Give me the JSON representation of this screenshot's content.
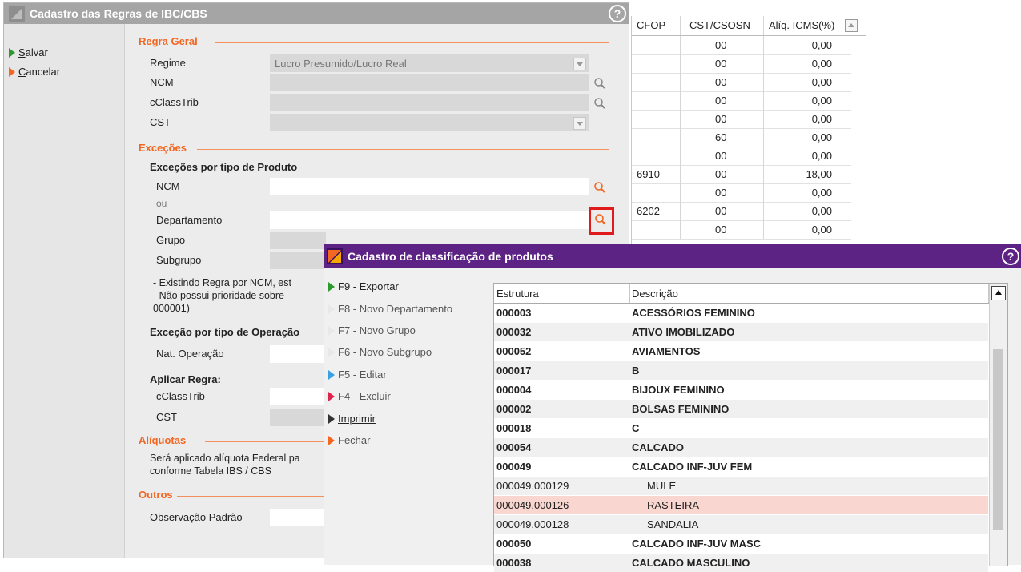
{
  "background_grid": {
    "columns": [
      "CFOP",
      "CST/CSOSN",
      "Alíq. ICMS(%)"
    ],
    "rows": [
      {
        "cfop": "",
        "cst": "00",
        "aliq": "0,00"
      },
      {
        "cfop": "",
        "cst": "00",
        "aliq": "0,00"
      },
      {
        "cfop": "",
        "cst": "00",
        "aliq": "0,00"
      },
      {
        "cfop": "",
        "cst": "00",
        "aliq": "0,00"
      },
      {
        "cfop": "",
        "cst": "00",
        "aliq": "0,00"
      },
      {
        "cfop": "",
        "cst": "60",
        "aliq": "0,00"
      },
      {
        "cfop": "",
        "cst": "00",
        "aliq": "0,00"
      },
      {
        "cfop": "6910",
        "cst": "00",
        "aliq": "18,00"
      },
      {
        "cfop": "",
        "cst": "00",
        "aliq": "0,00"
      },
      {
        "cfop": "6202",
        "cst": "00",
        "aliq": "0,00"
      },
      {
        "cfop": "",
        "cst": "00",
        "aliq": "0,00"
      }
    ]
  },
  "regras_window": {
    "title": "Cadastro das Regras de IBC/CBS",
    "help": "?",
    "actions": [
      {
        "label": "Salvar",
        "underline": "S",
        "rest": "alvar"
      },
      {
        "label": "Cancelar",
        "underline": "C",
        "rest": "ancelar"
      }
    ],
    "regra_geral": {
      "section": "Regra Geral",
      "regime_label": "Regime",
      "regime_value": "Lucro Presumido/Lucro Real",
      "ncm_label": "NCM",
      "cclasstrib_label": "cClassTrib",
      "cst_label": "CST"
    },
    "excecoes": {
      "section": "Exceções",
      "por_produto": "Exceções por tipo de Produto",
      "ncm_label": "NCM",
      "ou": "ou",
      "departamento_label": "Departamento",
      "grupo_label": "Grupo",
      "subgrupo_label": "Subgrupo",
      "note1": "- Existindo Regra por NCM, est",
      "note2": "- Não possui prioridade sobre",
      "note3": "000001)",
      "por_operacao": "Exceção por tipo de Operação",
      "nat_operacao_label": "Nat. Operação",
      "aplicar_regra": "Aplicar Regra:",
      "cclasstrib_label": "cClassTrib",
      "cst_label": "CST"
    },
    "aliquotas": {
      "section": "Alíquotas",
      "text1": "Será aplicado alíquota Federal pa",
      "text2": "conforme Tabela IBS / CBS"
    },
    "outros": {
      "section": "Outros",
      "obs_label": "Observação Padrão"
    }
  },
  "classificacao_window": {
    "title": "Cadastro de classificação de produtos",
    "help": "?",
    "menu": [
      {
        "key": "f9",
        "label": "F9 - Exportar",
        "color": "green"
      },
      {
        "key": "f8",
        "label": "F8 - Novo Departamento",
        "color": "disabled"
      },
      {
        "key": "f7",
        "label": "F7 - Novo Grupo",
        "color": "disabled"
      },
      {
        "key": "f6",
        "label": "F6 - Novo Subgrupo",
        "color": "disabled"
      },
      {
        "key": "f5",
        "label": "F5 - Editar",
        "color": "blue"
      },
      {
        "key": "f4",
        "label": "F4 - Excluir",
        "color": "red"
      },
      {
        "key": "imprimir",
        "label": "Imprimir",
        "color": "dark"
      },
      {
        "key": "fechar",
        "label": "Fechar",
        "color": "orange"
      }
    ],
    "columns": [
      "Estrutura",
      "Descrição"
    ],
    "rows": [
      {
        "estrutura": "000003",
        "descricao": "ACESSÓRIOS FEMININO",
        "bold": true
      },
      {
        "estrutura": "000032",
        "descricao": "ATIVO IMOBILIZADO",
        "bold": true
      },
      {
        "estrutura": "000052",
        "descricao": "AVIAMENTOS",
        "bold": true
      },
      {
        "estrutura": "000017",
        "descricao": "B",
        "bold": true
      },
      {
        "estrutura": "000004",
        "descricao": "BIJOUX FEMININO",
        "bold": true
      },
      {
        "estrutura": "000002",
        "descricao": "BOLSAS FEMININO",
        "bold": true
      },
      {
        "estrutura": "000018",
        "descricao": "C",
        "bold": true
      },
      {
        "estrutura": "000054",
        "descricao": "CALCADO",
        "bold": true
      },
      {
        "estrutura": "000049",
        "descricao": "CALCADO INF-JUV FEM",
        "bold": true
      },
      {
        "estrutura": "000049.000129",
        "descricao": "MULE",
        "bold": false
      },
      {
        "estrutura": "000049.000126",
        "descricao": "RASTEIRA",
        "bold": false,
        "selected": true
      },
      {
        "estrutura": "000049.000128",
        "descricao": "SANDALIA",
        "bold": false
      },
      {
        "estrutura": "000050",
        "descricao": "CALCADO INF-JUV MASC",
        "bold": true
      },
      {
        "estrutura": "000038",
        "descricao": "CALCADO MASCULINO",
        "bold": true
      }
    ]
  },
  "colors": {
    "accent_orange": "#f26722",
    "title_purple": "#5d2384",
    "title_gray": "#a5a5a5",
    "selected_row": "#f9d7d0",
    "highlight_box": "#e01b1b"
  }
}
